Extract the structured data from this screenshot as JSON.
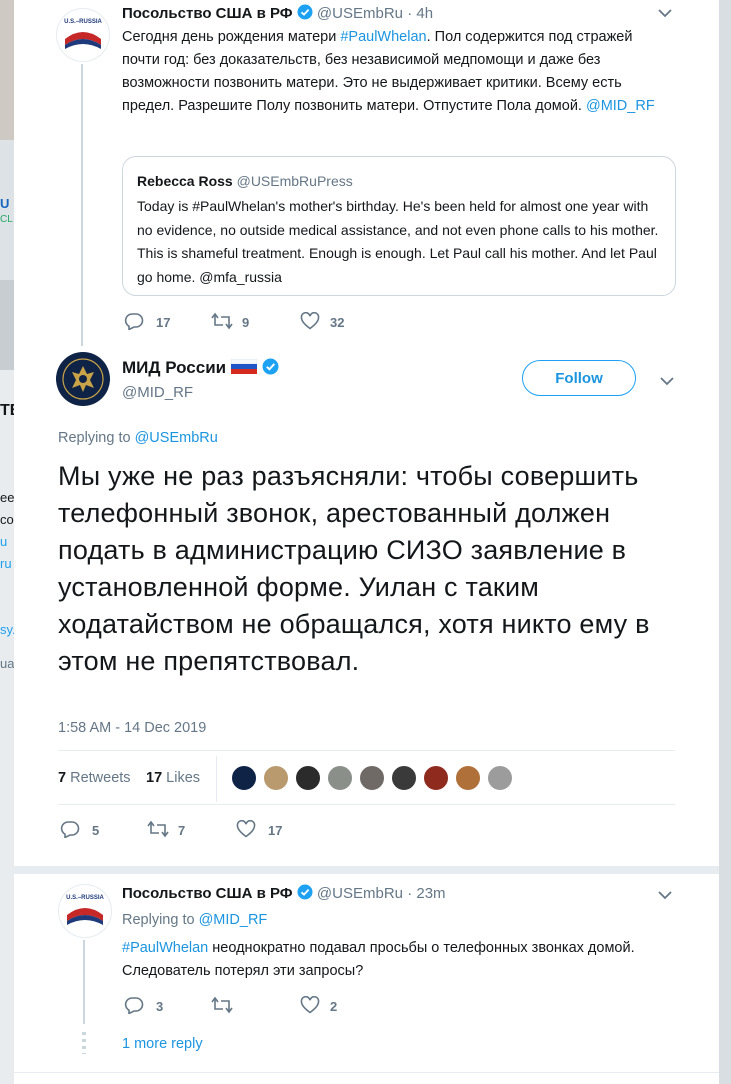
{
  "tweet1": {
    "name": "Посольство США в РФ",
    "handle": "@USEmbRu",
    "time": "· 4h",
    "avatar_text": "U.S.–RUSSIA",
    "text_plain": "Сегодня день рождения матери ",
    "hashtag": "#PaulWhelan",
    "text_rest": ". Пол содержится под стражей почти год: без доказательств, без независимой медпомощи и даже без возможности позвонить матери. Это не выдерживает критики. Всему есть предел. Разрешите Полу позвонить матери. Отпустите Пола домой. ",
    "mention": "@MID_RF",
    "quote": {
      "name": "Rebecca Ross",
      "handle": "@USEmbRuPress",
      "text": "Today is #PaulWhelan's mother's birthday. He's been held for almost one year with no evidence, no outside medical assistance, and not even phone calls to his mother. This is shameful treatment. Enough is enough. Let Paul call his mother. And let Paul go home. @mfa_russia"
    },
    "replies": "17",
    "retweets": "9",
    "likes": "32"
  },
  "tweet2": {
    "name": "МИД России",
    "handle": "@MID_RF",
    "follow_label": "Follow",
    "replying_prefix": "Replying to ",
    "replying_to": "@USEmbRu",
    "text": "Мы уже не раз разъясняли: чтобы совершить телефонный звонок, арестованный должен подать в администрацию СИЗО заявление в установленной форме. Уилан с таким ходатайством не обращался, хотя никто ему в этом не препятствовал.",
    "timestamp": "1:58 AM - 14 Dec 2019",
    "retweets_count": "7",
    "retweets_label": "Retweets",
    "likes_count": "17",
    "likes_label": "Likes",
    "replies": "5",
    "retweets": "7",
    "likes": "17"
  },
  "tweet3": {
    "name": "Посольство США в РФ",
    "handle": "@USEmbRu",
    "time": "· 23m",
    "avatar_text": "U.S.–RUSSIA",
    "replying_prefix": "Replying to ",
    "replying_to": "@MID_RF",
    "hashtag": "#PaulWhelan",
    "text_rest": " неоднократно подавал просьбы о телефонных звонках домой. Следователь потерял эти запросы?",
    "replies": "3",
    "retweets": "",
    "likes": "2"
  },
  "more_replies": "1 more reply",
  "colors": {
    "accent": "#1da1f2",
    "link": "#1b95e0",
    "muted": "#657786",
    "verified": "#1da1f2"
  },
  "background": {
    "left_letters": [
      "U",
      "CL",
      "TB",
      "ee",
      "co",
      "u",
      "ru",
      "sy.",
      "ua"
    ]
  }
}
